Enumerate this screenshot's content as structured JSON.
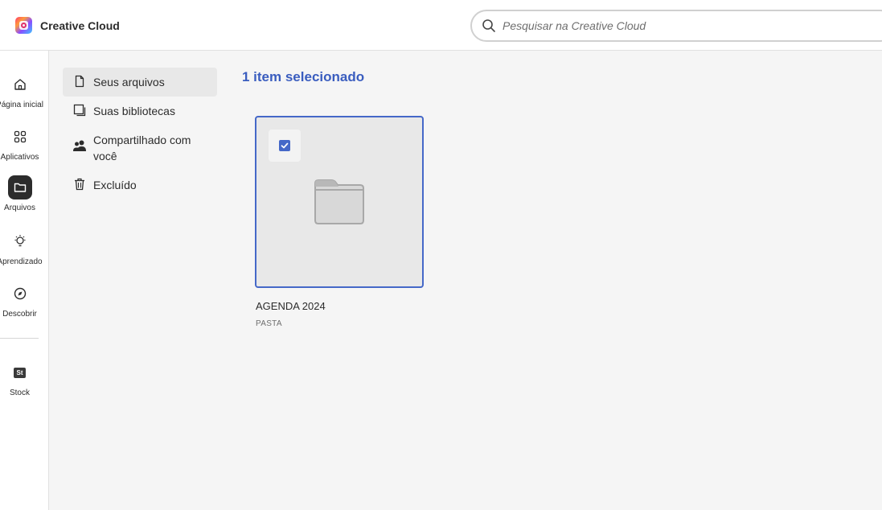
{
  "header": {
    "brand_name": "Creative Cloud",
    "search_placeholder": "Pesquisar na Creative Cloud"
  },
  "rail": {
    "items": [
      {
        "label": "Página inicial",
        "icon": "home-icon"
      },
      {
        "label": "Aplicativos",
        "icon": "grid-icon"
      },
      {
        "label": "Arquivos",
        "icon": "folder-icon",
        "active": true
      },
      {
        "label": "Aprendizado",
        "icon": "lightbulb-icon"
      },
      {
        "label": "Descobrir",
        "icon": "compass-icon"
      }
    ],
    "stock": {
      "label": "Stock",
      "badge": "St"
    }
  },
  "filenav": {
    "items": [
      {
        "label": "Seus arquivos",
        "icon": "document-icon",
        "active": true
      },
      {
        "label": "Suas bibliotecas",
        "icon": "library-icon"
      },
      {
        "label": "Compartilhado com você",
        "icon": "people-icon"
      },
      {
        "label": "Excluído",
        "icon": "trash-icon"
      }
    ]
  },
  "main": {
    "selection_title": "1 item selecionado",
    "items": [
      {
        "name": "AGENDA 2024",
        "type": "PASTA",
        "selected": true
      }
    ]
  },
  "colors": {
    "accent": "#4568c8",
    "title_blue": "#3a5dbf",
    "rail_active_bg": "#2c2c2c"
  }
}
